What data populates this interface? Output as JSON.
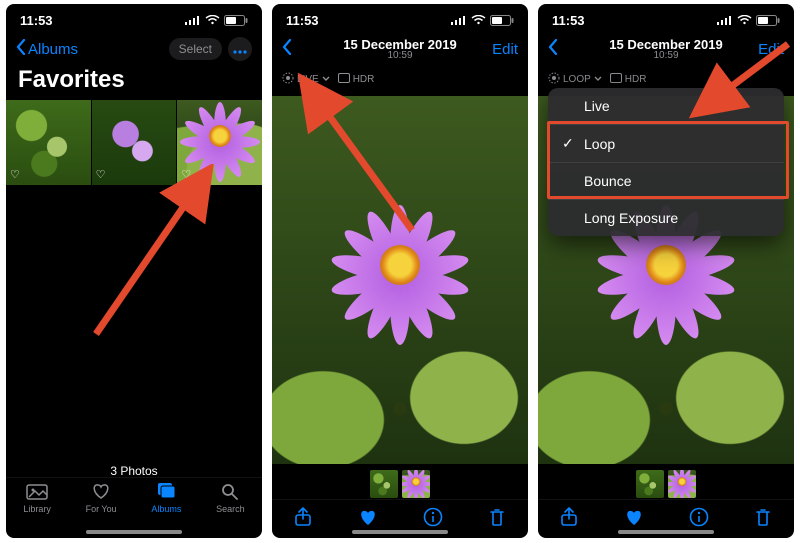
{
  "status": {
    "time": "11:53"
  },
  "colors": {
    "accent": "#0a84ff",
    "annotation": "#e2492d"
  },
  "screen1": {
    "back_label": "Albums",
    "select_label": "Select",
    "title": "Favorites",
    "count_label": "3 Photos",
    "tabs": [
      {
        "label": "Library",
        "icon": "library-icon"
      },
      {
        "label": "For You",
        "icon": "foryou-icon"
      },
      {
        "label": "Albums",
        "icon": "albums-icon"
      },
      {
        "label": "Search",
        "icon": "search-icon"
      }
    ],
    "active_tab": 2,
    "thumbnails": [
      {
        "kind": "green",
        "favorite": true
      },
      {
        "kind": "purple",
        "favorite": true
      },
      {
        "kind": "lily",
        "favorite": true
      }
    ]
  },
  "screen2": {
    "date": "15 December 2019",
    "time": "10:59",
    "edit_label": "Edit",
    "badges": [
      {
        "id": "live",
        "label": "LIVE",
        "chevron": true
      },
      {
        "id": "hdr",
        "label": "HDR"
      }
    ],
    "toolbar": [
      "share",
      "favorite",
      "info",
      "trash"
    ],
    "mini_thumbs": [
      "green",
      "lily"
    ]
  },
  "screen3": {
    "date": "15 December 2019",
    "time": "10:59",
    "edit_label": "Edit",
    "badges": [
      {
        "id": "loop",
        "label": "LOOP",
        "chevron": true
      },
      {
        "id": "hdr",
        "label": "HDR"
      }
    ],
    "menu": [
      {
        "label": "Live",
        "checked": false
      },
      {
        "label": "Loop",
        "checked": true
      },
      {
        "label": "Bounce",
        "checked": false
      },
      {
        "label": "Long Exposure",
        "checked": false
      }
    ],
    "highlight_rows": [
      1,
      2
    ],
    "toolbar": [
      "share",
      "favorite",
      "info",
      "trash"
    ],
    "mini_thumbs": [
      "green",
      "lily"
    ]
  }
}
